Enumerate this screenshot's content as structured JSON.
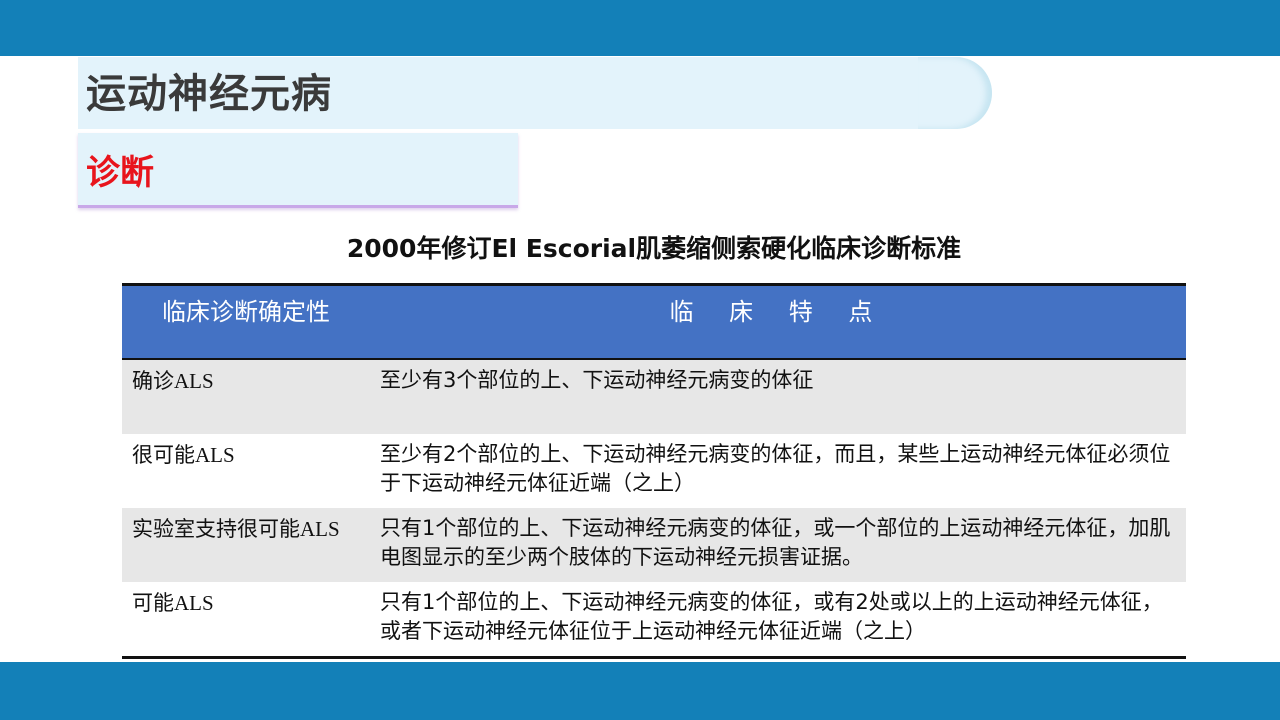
{
  "header": {
    "title": "运动神经元病",
    "section": "诊断"
  },
  "table": {
    "caption": "2000年修订El Escorial肌萎缩侧索硬化临床诊断标准",
    "columns": [
      "临床诊断确定性",
      "临 床 特 点"
    ],
    "rows": [
      {
        "certainty": "确诊ALS",
        "features": "至少有3个部位的上、下运动神经元病变的体征"
      },
      {
        "certainty": "很可能ALS",
        "features": "至少有2个部位的上、下运动神经元病变的体征，而且，某些上运动神经元体征必须位于下运动神经元体征近端（之上）"
      },
      {
        "certainty": "实验室支持很可能ALS",
        "features": "只有1个部位的上、下运动神经元病变的体征，或一个部位的上运动神经元体征，加肌电图显示的至少两个肢体的下运动神经元损害证据。"
      },
      {
        "certainty": "可能ALS",
        "features": "只有1个部位的上、下运动神经元病变的体征，或有2处或以上的上运动神经元体征，或者下运动神经元体征位于上运动神经元体征近端（之上）"
      }
    ]
  },
  "colors": {
    "bar": "#1380b8",
    "header_fill": "#4472c4",
    "section_red": "#e8141c",
    "band": "#e3f3fb",
    "row_shade": "#e7e7e7"
  }
}
